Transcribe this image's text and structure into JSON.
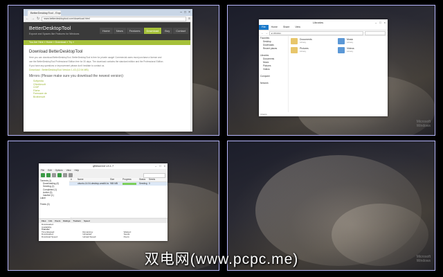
{
  "watermark": {
    "line1": "Microsoft",
    "line2": "Windows"
  },
  "caption": "双电网(www.pcpc.me)",
  "browser": {
    "tab_title": "BetterDesktopTool - Expo",
    "url": "www.betterdesktoptool.com/download.html",
    "logo": "BetterDesktopTool",
    "tagline": "Exposé and Spaces like Features for Windows",
    "nav": [
      "Home",
      "News",
      "Features",
      "Download",
      "Buy",
      "Contact"
    ],
    "breadcrumb": "You Are Here » Home » Download » Try »",
    "heading": "Download BetterDesktopTool",
    "paragraphs": [
      "Here you can download BetterDesktopTool. BetterDesktopTool is free for private usage! Commercial users must purchase a license and",
      "use the BetterDesktopTool Professional Edition free for 30 days. The download contains the standard edition and the Professional Edition.",
      "If you have any questions or improvement please don't hesitate to contact us."
    ],
    "download_link": "Download : BetterDesktopTool Version 1.43 (12.94 MB)",
    "mirrors_heading": "Mirrors (Please make sure you download the newest version):",
    "mirrors": [
      "Softpedia",
      "CNetAnsoft",
      "CHIP",
      "Filehe",
      "Freeware de",
      "Brothersoft"
    ]
  },
  "explorer": {
    "title": "Libraries",
    "ribbon": [
      "File",
      "Home",
      "Share",
      "View"
    ],
    "address": "▸ Libraries",
    "nav": [
      {
        "label": "Favorites",
        "indent": false
      },
      {
        "label": "Desktop",
        "indent": true
      },
      {
        "label": "Downloads",
        "indent": true
      },
      {
        "label": "Recent places",
        "indent": true
      },
      {
        "label": "",
        "indent": false
      },
      {
        "label": "Libraries",
        "indent": false
      },
      {
        "label": "Documents",
        "indent": true
      },
      {
        "label": "Music",
        "indent": true
      },
      {
        "label": "Pictures",
        "indent": true
      },
      {
        "label": "Videos",
        "indent": true
      },
      {
        "label": "",
        "indent": false
      },
      {
        "label": "Computer",
        "indent": false
      },
      {
        "label": "",
        "indent": false
      },
      {
        "label": "Network",
        "indent": false
      }
    ],
    "libraries": [
      {
        "name": "Documents",
        "sub": "Library"
      },
      {
        "name": "Music",
        "sub": "Library"
      },
      {
        "name": "Pictures",
        "sub": "Library"
      },
      {
        "name": "Videos",
        "sub": "Library"
      }
    ],
    "status": "4 items"
  },
  "torrent": {
    "title": "qBittorrent v3.1.7",
    "menu": [
      "File",
      "Edit",
      "Options",
      "View",
      "Help"
    ],
    "sidebar": [
      {
        "label": "Torrents (1)",
        "indent": false
      },
      {
        "label": "Downloading (0)",
        "indent": true
      },
      {
        "label": "Seeding (1)",
        "indent": true
      },
      {
        "label": "Completed (1)",
        "indent": true
      },
      {
        "label": "Active (0)",
        "indent": true
      },
      {
        "label": "Inactive (1)",
        "indent": true
      },
      {
        "label": "Label",
        "indent": false
      },
      {
        "label": "",
        "indent": false
      },
      {
        "label": "Feeds (0)",
        "indent": false
      }
    ],
    "columns": [
      "#",
      "Name",
      "Size",
      "Progress",
      "Status",
      "Seeds"
    ],
    "row": {
      "num": "",
      "name": "ubuntu-14.04-desktop-amd64.iso",
      "size": "965 MB",
      "progress": 1.0,
      "status": "Seeding",
      "seeds": "0"
    },
    "bottom_tabs": [
      "Files",
      "Info",
      "Peers",
      "Ratings",
      "Trackers",
      "Speed"
    ],
    "details": {
      "downloaded": "Downloaded:",
      "availability": "Availability:",
      "transfer": "Transfer",
      "fields": [
        "Time Elapsed:",
        "Remaining:",
        "Wasted:",
        "Downloaded:",
        "Uploaded:",
        "Seeds:",
        "Download Speed:",
        "Upload Speed:",
        "Peers:"
      ]
    }
  }
}
